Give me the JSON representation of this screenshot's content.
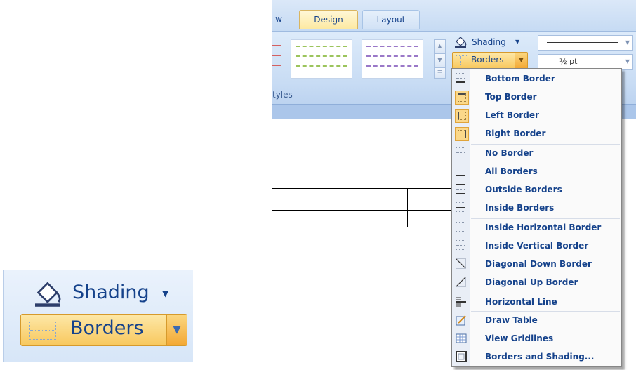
{
  "ribbon": {
    "tabs": [
      {
        "label": "w"
      },
      {
        "label": "Design",
        "active": true
      },
      {
        "label": "Layout"
      }
    ],
    "group_label": "tyles",
    "shading_label": "Shading",
    "borders_label": "Borders",
    "line_weight_label": "½ pt"
  },
  "borders_menu": {
    "items": [
      {
        "label": "Bottom Border",
        "icon": "bottom-border-icon"
      },
      {
        "label": "Top Border",
        "icon": "top-border-icon",
        "highlighted": true
      },
      {
        "label": "Left Border",
        "icon": "left-border-icon",
        "highlighted": true
      },
      {
        "label": "Right Border",
        "icon": "right-border-icon",
        "highlighted": true
      },
      {
        "label": "No Border",
        "icon": "no-border-icon"
      },
      {
        "label": "All Borders",
        "icon": "all-borders-icon"
      },
      {
        "label": "Outside Borders",
        "icon": "outside-borders-icon"
      },
      {
        "label": "Inside Borders",
        "icon": "inside-borders-icon"
      },
      {
        "label": "Inside Horizontal Border",
        "icon": "inside-horizontal-border-icon"
      },
      {
        "label": "Inside Vertical Border",
        "icon": "inside-vertical-border-icon"
      },
      {
        "label": "Diagonal Down Border",
        "icon": "diagonal-down-border-icon"
      },
      {
        "label": "Diagonal Up Border",
        "icon": "diagonal-up-border-icon"
      },
      {
        "label": "Horizontal Line",
        "icon": "horizontal-line-icon"
      },
      {
        "label": "Draw Table",
        "icon": "draw-table-icon"
      },
      {
        "label": "View Gridlines",
        "icon": "view-gridlines-icon"
      },
      {
        "label": "Borders and Shading...",
        "icon": "borders-and-shading-icon"
      }
    ]
  },
  "zoom_inset": {
    "shading_label": "Shading",
    "borders_label": "Borders"
  },
  "colors": {
    "ribbon_text": "#15428b",
    "highlight": "#fbd88a",
    "active_tab": "#fde9a2"
  }
}
